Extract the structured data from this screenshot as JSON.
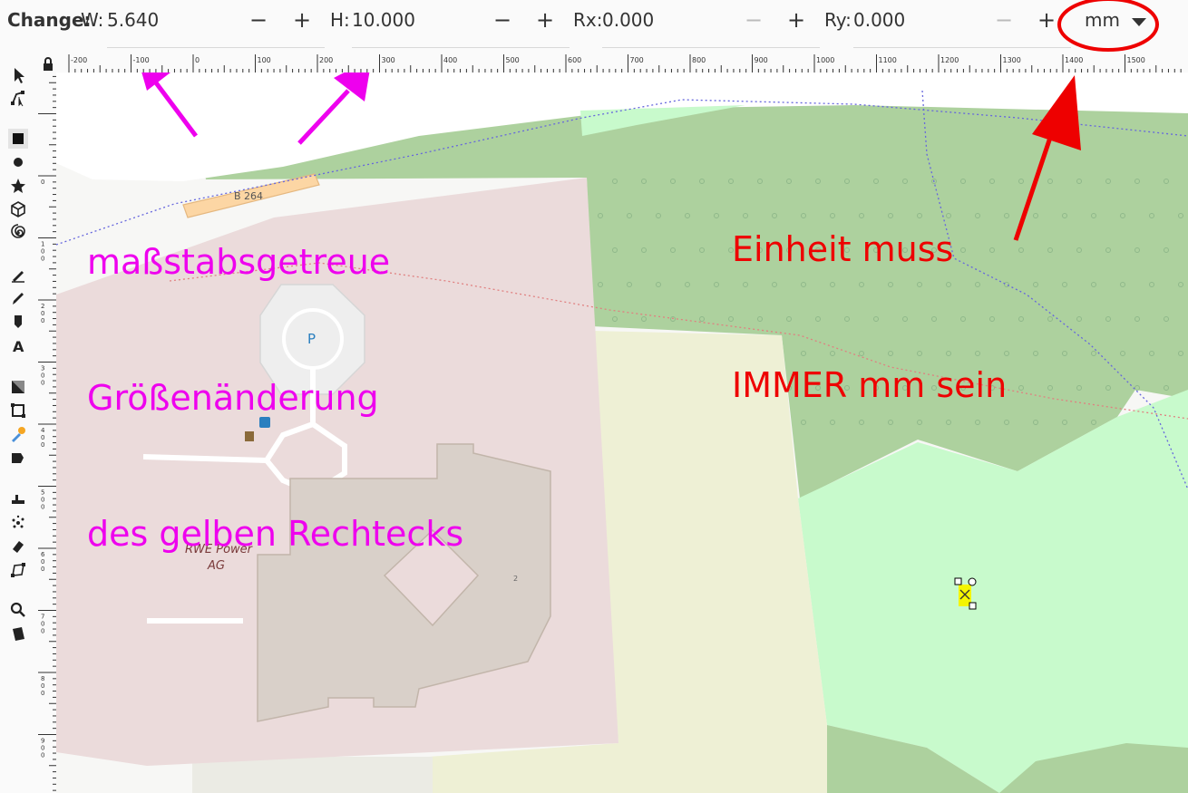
{
  "toolbar": {
    "change_label": "Change:",
    "w_label": "W:",
    "w_value": "5.640",
    "h_label": "H:",
    "h_value": "10.000",
    "rx_label": "Rx:",
    "rx_value": "0.000",
    "ry_label": "Ry:",
    "ry_value": "0.000",
    "minus": "−",
    "plus": "+",
    "unit": "mm"
  },
  "ruler": {
    "h_ticks": [
      "-200",
      "-100",
      "0",
      "100",
      "200",
      "300",
      "400",
      "500",
      "600",
      "700",
      "800",
      "900",
      "1000",
      "1100",
      "1200",
      "1300",
      "1400",
      "1500"
    ],
    "v_ticks": [
      "0",
      "100",
      "200",
      "300",
      "400",
      "500",
      "600",
      "700",
      "800",
      "900"
    ]
  },
  "map": {
    "road_label": "B 264",
    "parking_label": "P",
    "company_label_1": "RWE Power",
    "company_label_2": "AG",
    "building_number": "2"
  },
  "annotations": {
    "magenta_lines": [
      "maßstabsgetreue",
      "Größenänderung",
      "des gelben Rechtecks"
    ],
    "red_lines": [
      "Einheit muss",
      "IMMER mm sein"
    ]
  },
  "colors": {
    "annotation_magenta": "#ee00ee",
    "annotation_red": "#ee0000",
    "forest": "#add19e",
    "meadow": "#c8facc",
    "industrial": "#ebdbe8",
    "building": "#d9d0c9",
    "farmland": "#eef0d5"
  }
}
